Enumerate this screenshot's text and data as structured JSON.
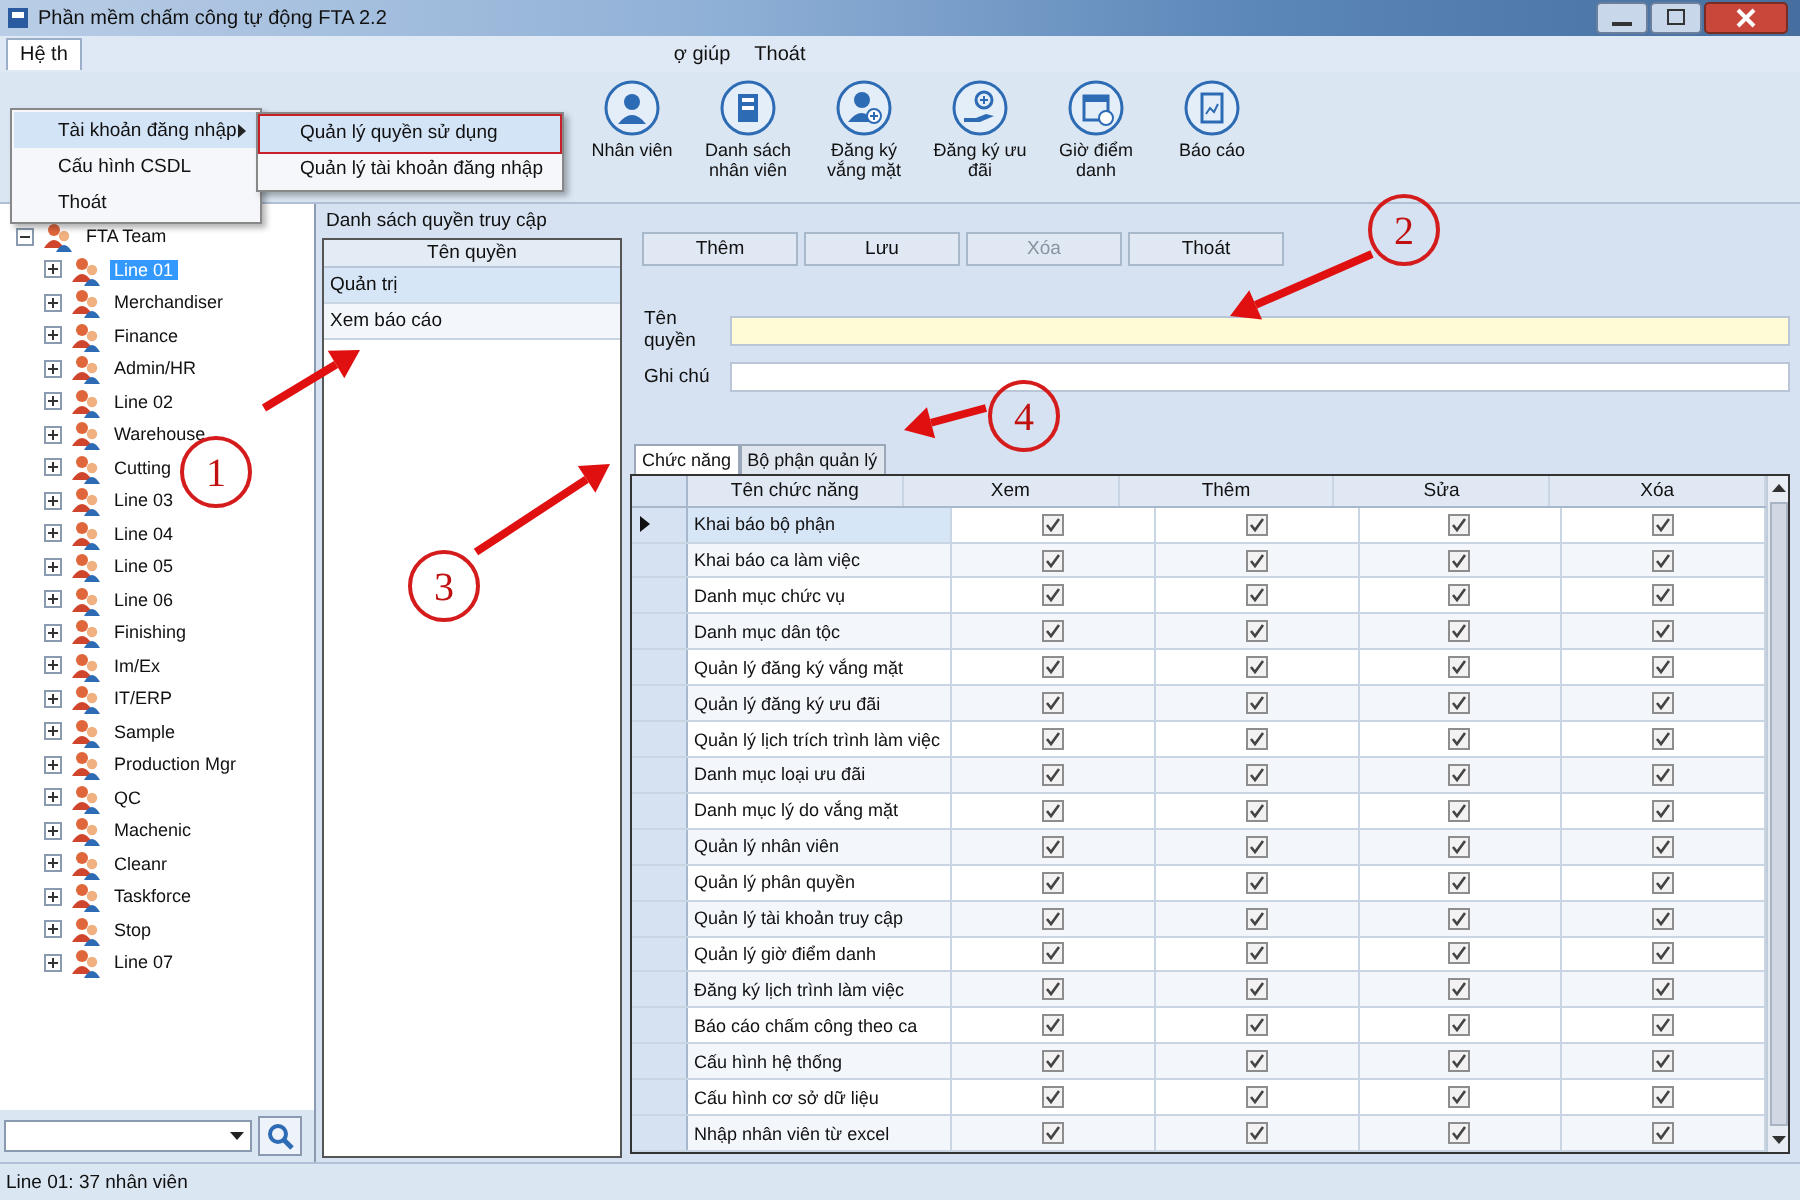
{
  "window": {
    "title": "Phần mềm chấm công tự động FTA 2.2"
  },
  "menu": [
    {
      "label": "Hệ th",
      "selected": true
    },
    {
      "label": "ợ giúp",
      "selected": false
    },
    {
      "label": "Thoát",
      "selected": false
    }
  ],
  "open_menu": {
    "items": [
      {
        "label": "Tài khoản đăng nhập",
        "selected": true,
        "submenu": true
      },
      {
        "label": "Cấu hình CSDL",
        "selected": false,
        "submenu": false
      },
      {
        "label": "Thoát",
        "selected": false,
        "submenu": false
      }
    ],
    "submenu": [
      {
        "label": "Quản lý quyền sử dụng",
        "selected": true
      },
      {
        "label": "Quản lý tài khoản đăng nhập",
        "selected": false
      }
    ]
  },
  "toolbar": [
    {
      "label": "Nhân viên",
      "kind": "person"
    },
    {
      "label": "Danh sách nhân viên",
      "kind": "list"
    },
    {
      "label": "Đăng ký vắng mặt",
      "kind": "person-add"
    },
    {
      "label": "Đăng ký ưu đãi",
      "kind": "hand"
    },
    {
      "label": "Giờ điểm danh",
      "kind": "calendar"
    },
    {
      "label": "Báo cáo",
      "kind": "report"
    }
  ],
  "tree": {
    "label": "FTA Team",
    "expanded": true,
    "children": [
      {
        "label": "Line 01",
        "selected": true,
        "expanded": false
      },
      {
        "label": "Merchandiser",
        "selected": false,
        "expanded": false
      },
      {
        "label": "Finance",
        "selected": false,
        "expanded": false
      },
      {
        "label": "Admin/HR",
        "selected": false,
        "expanded": false
      },
      {
        "label": "Line 02",
        "selected": false,
        "expanded": false
      },
      {
        "label": "Warehouse",
        "selected": false,
        "expanded": false
      },
      {
        "label": "Cutting",
        "selected": false,
        "expanded": false
      },
      {
        "label": "Line 03",
        "selected": false,
        "expanded": false
      },
      {
        "label": "Line 04",
        "selected": false,
        "expanded": false
      },
      {
        "label": "Line 05",
        "selected": false,
        "expanded": false
      },
      {
        "label": "Line 06",
        "selected": false,
        "expanded": false
      },
      {
        "label": "Finishing",
        "selected": false,
        "expanded": false
      },
      {
        "label": "Im/Ex",
        "selected": false,
        "expanded": false
      },
      {
        "label": "IT/ERP",
        "selected": false,
        "expanded": false
      },
      {
        "label": "Sample",
        "selected": false,
        "expanded": false
      },
      {
        "label": "Production Mgr",
        "selected": false,
        "expanded": false
      },
      {
        "label": "QC",
        "selected": false,
        "expanded": false
      },
      {
        "label": "Machenic",
        "selected": false,
        "expanded": false
      },
      {
        "label": "Cleanr",
        "selected": false,
        "expanded": false
      },
      {
        "label": "Taskforce",
        "selected": false,
        "expanded": false
      },
      {
        "label": "Stop",
        "selected": false,
        "expanded": false
      },
      {
        "label": "Line 07",
        "selected": false,
        "expanded": false
      }
    ]
  },
  "roles_panel": {
    "title": "Danh sách quyền truy cập",
    "column": "Tên quyền",
    "items": [
      {
        "label": "Quản trị",
        "selected": true
      },
      {
        "label": "Xem báo cáo",
        "selected": false
      }
    ]
  },
  "buttons": [
    {
      "label": "Thêm",
      "disabled": false
    },
    {
      "label": "Lưu",
      "disabled": false
    },
    {
      "label": "Xóa",
      "disabled": true
    },
    {
      "label": "Thoát",
      "disabled": false
    }
  ],
  "fields": [
    {
      "label": "Tên quyền",
      "focused": true
    },
    {
      "label": "Ghi chú",
      "focused": false
    }
  ],
  "tabs": [
    {
      "label": "Chức năng",
      "selected": true
    },
    {
      "label": "Bộ phận quản lý",
      "selected": false
    }
  ],
  "grid": {
    "columns": [
      "Tên chức năng",
      "Xem",
      "Thêm",
      "Sửa",
      "Xóa"
    ],
    "rows": [
      {
        "name": "Khai báo bộ phận",
        "selected": true,
        "checks": [
          true,
          true,
          true,
          true
        ]
      },
      {
        "name": "Khai báo ca làm việc",
        "selected": false,
        "checks": [
          true,
          true,
          true,
          true
        ]
      },
      {
        "name": "Danh mục chức vụ",
        "selected": false,
        "checks": [
          true,
          true,
          true,
          true
        ]
      },
      {
        "name": "Danh mục dân tộc",
        "selected": false,
        "checks": [
          true,
          true,
          true,
          true
        ]
      },
      {
        "name": "Quản lý đăng ký vắng mặt",
        "selected": false,
        "checks": [
          true,
          true,
          true,
          true
        ]
      },
      {
        "name": "Quản lý đăng ký ưu đãi",
        "selected": false,
        "checks": [
          true,
          true,
          true,
          true
        ]
      },
      {
        "name": "Quản lý lịch trích trình làm việc",
        "selected": false,
        "checks": [
          true,
          true,
          true,
          true
        ]
      },
      {
        "name": "Danh mục loại ưu đãi",
        "selected": false,
        "checks": [
          true,
          true,
          true,
          true
        ]
      },
      {
        "name": "Danh mục lý do vắng mặt",
        "selected": false,
        "checks": [
          true,
          true,
          true,
          true
        ]
      },
      {
        "name": "Quản lý nhân viên",
        "selected": false,
        "checks": [
          true,
          true,
          true,
          true
        ]
      },
      {
        "name": "Quản lý phân quyền",
        "selected": false,
        "checks": [
          true,
          true,
          true,
          true
        ]
      },
      {
        "name": "Quản lý tài khoản truy cập",
        "selected": false,
        "checks": [
          true,
          true,
          true,
          true
        ]
      },
      {
        "name": "Quản lý giờ điểm danh",
        "selected": false,
        "checks": [
          true,
          true,
          true,
          true
        ]
      },
      {
        "name": "Đăng ký lịch trình làm việc",
        "selected": false,
        "checks": [
          true,
          true,
          true,
          true
        ]
      },
      {
        "name": "Báo cáo chấm công theo ca",
        "selected": false,
        "checks": [
          true,
          true,
          true,
          true
        ]
      },
      {
        "name": "Cấu hình hệ thống",
        "selected": false,
        "checks": [
          true,
          true,
          true,
          true
        ]
      },
      {
        "name": "Cấu hình cơ sở dữ liệu",
        "selected": false,
        "checks": [
          true,
          true,
          true,
          true
        ]
      },
      {
        "name": "Nhập nhân viên từ excel",
        "selected": false,
        "checks": [
          true,
          true,
          true,
          true
        ]
      }
    ]
  },
  "status_bar": "Line 01: 37 nhân viên",
  "annotations": [
    {
      "number": "1"
    },
    {
      "number": "2"
    },
    {
      "number": "3"
    },
    {
      "number": "4"
    }
  ]
}
